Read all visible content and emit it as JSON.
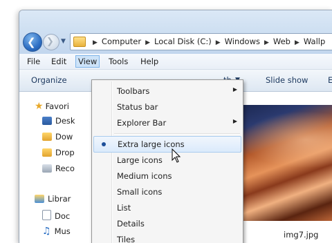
{
  "address": {
    "crumbs": [
      "Computer",
      "Local Disk (C:)",
      "Windows",
      "Web",
      "Wallp"
    ]
  },
  "menubar": {
    "file": "File",
    "edit": "Edit",
    "view": "View",
    "tools": "Tools",
    "help": "Help"
  },
  "toolbar": {
    "organize": "Organize",
    "width_fragment": "th",
    "slideshow": "Slide show",
    "edge_fragment": "E"
  },
  "navpane": {
    "favorites": "Favori",
    "desktop": "Desk",
    "downloads": "Dow",
    "dropbox": "Drop",
    "recent": "Reco",
    "libraries": "Librar",
    "documents": "Doc",
    "music": "Mus"
  },
  "content": {
    "thumb_caption": "img7.jpg"
  },
  "view_menu": {
    "items": [
      {
        "label": "Toolbars",
        "submenu": true
      },
      {
        "label": "Status bar"
      },
      {
        "label": "Explorer Bar",
        "submenu": true
      },
      {
        "label": "Extra large icons",
        "selected": true
      },
      {
        "label": "Large icons"
      },
      {
        "label": "Medium icons"
      },
      {
        "label": "Small icons"
      },
      {
        "label": "List"
      },
      {
        "label": "Details"
      },
      {
        "label": "Tiles"
      }
    ]
  }
}
